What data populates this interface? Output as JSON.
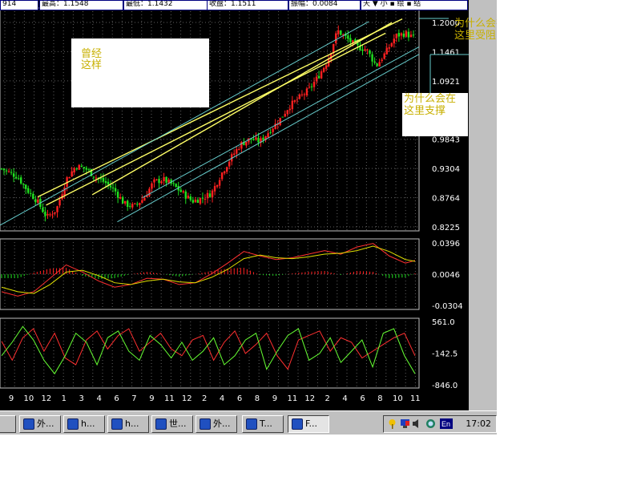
{
  "header_cells": [
    "914",
    "最高：1.1548",
    "最低：1.1432",
    "收盘：1.1511",
    "振幅：0.0084",
    "天 ▼ 小 ▪ 绘 ▪ 结"
  ],
  "annotations": {
    "left_box": [
      "曾经",
      "这样"
    ],
    "resistance": [
      "为什么会在",
      "这里受阻"
    ],
    "support": [
      "为什么会在",
      "这里支撑"
    ]
  },
  "chart_data": [
    {
      "type": "candlestick",
      "y_ticks": [
        "1.2000",
        "1.1461",
        "1.0921",
        "0.9843",
        "0.9304",
        "0.8764",
        "0.8225"
      ],
      "ylim": [
        0.8225,
        1.2
      ],
      "x_ticks": [
        "9",
        "10",
        "12",
        "1",
        "3",
        "4",
        "6",
        "7",
        "9",
        "11",
        "12",
        "2",
        "4",
        "6",
        "8",
        "9",
        "11",
        "12",
        "2",
        "4",
        "6",
        "8",
        "10",
        "11"
      ],
      "close_path": [
        [
          0,
          0.93
        ],
        [
          5,
          0.915
        ],
        [
          8,
          0.89
        ],
        [
          11,
          0.87
        ],
        [
          14,
          0.84
        ],
        [
          17,
          0.855
        ],
        [
          20,
          0.91
        ],
        [
          23,
          0.935
        ],
        [
          26,
          0.93
        ],
        [
          29,
          0.915
        ],
        [
          32,
          0.905
        ],
        [
          35,
          0.89
        ],
        [
          38,
          0.865
        ],
        [
          41,
          0.86
        ],
        [
          44,
          0.875
        ],
        [
          47,
          0.905
        ],
        [
          50,
          0.91
        ],
        [
          53,
          0.9
        ],
        [
          56,
          0.885
        ],
        [
          59,
          0.87
        ],
        [
          62,
          0.875
        ],
        [
          65,
          0.885
        ],
        [
          68,
          0.92
        ],
        [
          71,
          0.95
        ],
        [
          74,
          0.975
        ],
        [
          77,
          0.985
        ],
        [
          80,
          0.98
        ],
        [
          83,
          1.0
        ],
        [
          86,
          1.02
        ],
        [
          89,
          1.045
        ],
        [
          92,
          1.06
        ],
        [
          95,
          1.075
        ],
        [
          98,
          1.1
        ],
        [
          101,
          1.13
        ],
        [
          104,
          1.185
        ],
        [
          107,
          1.17
        ],
        [
          110,
          1.155
        ],
        [
          113,
          1.15
        ],
        [
          116,
          1.12
        ],
        [
          119,
          1.145
        ],
        [
          122,
          1.175
        ],
        [
          125,
          1.18
        ],
        [
          128,
          1.17
        ]
      ],
      "trend_lines": [
        {
          "name": "",
          "color": "#ffff66",
          "points": [
            [
              0.09,
              0.8779
            ],
            [
              0.96,
              1.2064
            ]
          ]
        },
        {
          "name": "",
          "color": "#ffff66",
          "points": [
            [
              0.11,
              0.8626
            ],
            [
              0.92,
              1.1802
            ]
          ]
        },
        {
          "name": "",
          "color": "#ffff66",
          "points": [
            [
              0.22,
              0.8818
            ],
            [
              0.935,
              1.1998
            ]
          ]
        },
        {
          "name": "",
          "color": "#66cccc",
          "points": [
            [
              0.0,
              0.8256
            ],
            [
              0.88,
              1.2016
            ]
          ]
        },
        {
          "name": "",
          "color": "#66cccc",
          "points": [
            [
              0.28,
              0.8318
            ],
            [
              1.0,
              1.1413
            ]
          ]
        },
        {
          "name": "",
          "color": "#66cccc",
          "points": [
            [
              0.34,
              0.8764
            ],
            [
              1.0,
              1.155
            ]
          ]
        }
      ],
      "grid": true
    },
    {
      "type": "macd",
      "y_ticks": [
        "0.0396",
        "0.0046",
        "-0.0304"
      ],
      "ylim": [
        -0.0304,
        0.0396
      ],
      "dif": [
        [
          0,
          -0.02
        ],
        [
          10,
          -0.025
        ],
        [
          20,
          -0.02
        ],
        [
          30,
          -0.005
        ],
        [
          40,
          0.01
        ],
        [
          50,
          0.002
        ],
        [
          60,
          -0.008
        ],
        [
          70,
          -0.015
        ],
        [
          80,
          -0.012
        ],
        [
          90,
          -0.005
        ],
        [
          100,
          -0.006
        ],
        [
          110,
          -0.012
        ],
        [
          120,
          -0.01
        ],
        [
          130,
          0.0
        ],
        [
          140,
          0.012
        ],
        [
          150,
          0.025
        ],
        [
          160,
          0.02
        ],
        [
          170,
          0.016
        ],
        [
          180,
          0.018
        ],
        [
          190,
          0.022
        ],
        [
          200,
          0.026
        ],
        [
          210,
          0.022
        ],
        [
          220,
          0.03
        ],
        [
          230,
          0.034
        ],
        [
          240,
          0.02
        ],
        [
          250,
          0.012
        ],
        [
          256,
          0.015
        ]
      ],
      "dea": [
        [
          0,
          -0.015
        ],
        [
          10,
          -0.02
        ],
        [
          20,
          -0.022
        ],
        [
          30,
          -0.012
        ],
        [
          40,
          0.002
        ],
        [
          50,
          0.004
        ],
        [
          60,
          -0.002
        ],
        [
          70,
          -0.01
        ],
        [
          80,
          -0.012
        ],
        [
          90,
          -0.008
        ],
        [
          100,
          -0.006
        ],
        [
          110,
          -0.009
        ],
        [
          120,
          -0.01
        ],
        [
          130,
          -0.004
        ],
        [
          140,
          0.005
        ],
        [
          150,
          0.017
        ],
        [
          160,
          0.021
        ],
        [
          170,
          0.018
        ],
        [
          180,
          0.017
        ],
        [
          190,
          0.019
        ],
        [
          200,
          0.022
        ],
        [
          210,
          0.023
        ],
        [
          220,
          0.026
        ],
        [
          230,
          0.031
        ],
        [
          240,
          0.025
        ],
        [
          250,
          0.016
        ],
        [
          256,
          0.014
        ]
      ]
    },
    {
      "type": "oscillator",
      "y_ticks": [
        "561.0",
        "-142.5",
        "-846.0"
      ],
      "ylim": [
        -846.0,
        561.0
      ],
      "series": [
        {
          "name": "",
          "color": "#ff3030",
          "values": [
            120,
            -300,
            200,
            400,
            -100,
            300,
            -250,
            -400,
            150,
            350,
            -50,
            250,
            400,
            -100,
            100,
            300,
            -50,
            -200,
            150,
            250,
            -300,
            100,
            350,
            -150,
            50,
            300,
            -200,
            -500,
            150,
            250,
            350,
            -100,
            200,
            100,
            -250,
            -100,
            50,
            200,
            300,
            -200
          ]
        },
        {
          "name": "",
          "color": "#66ff33",
          "values": [
            -200,
            100,
            450,
            150,
            -300,
            -600,
            -200,
            300,
            100,
            -400,
            200,
            350,
            -100,
            -300,
            250,
            50,
            -250,
            100,
            -300,
            -100,
            200,
            -400,
            -200,
            150,
            300,
            -500,
            -100,
            250,
            400,
            -300,
            -150,
            200,
            -350,
            -100,
            150,
            -450,
            300,
            400,
            -200,
            -600
          ]
        }
      ]
    }
  ],
  "taskbar": {
    "buttons": [
      "外...",
      "h...",
      "h...",
      "世...",
      "外...",
      "T...",
      "F..."
    ],
    "clock": "17:02"
  }
}
